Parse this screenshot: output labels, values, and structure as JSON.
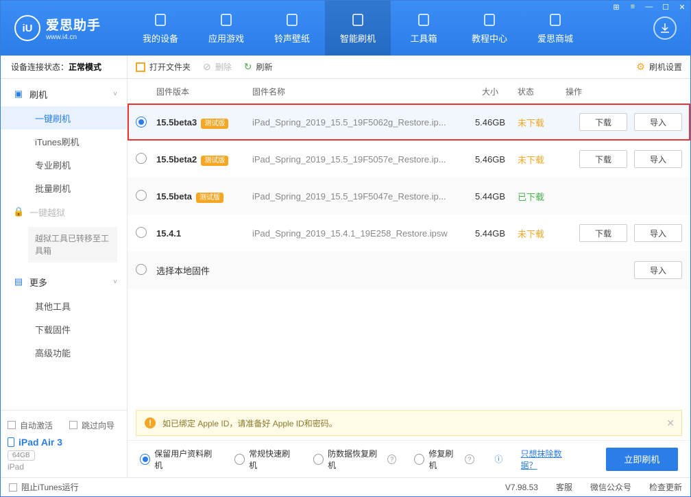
{
  "titlebar_icons": [
    "grid",
    "list",
    "min",
    "max",
    "close"
  ],
  "logo": {
    "cn": "爱思助手",
    "en": "www.i4.cn",
    "mark": "iU"
  },
  "nav": [
    {
      "id": "device",
      "label": "我的设备"
    },
    {
      "id": "apps",
      "label": "应用游戏"
    },
    {
      "id": "ringtone",
      "label": "铃声壁纸"
    },
    {
      "id": "flash",
      "label": "智能刷机"
    },
    {
      "id": "toolbox",
      "label": "工具箱"
    },
    {
      "id": "tutorial",
      "label": "教程中心"
    },
    {
      "id": "store",
      "label": "爱思商城"
    }
  ],
  "nav_active": "flash",
  "conn": {
    "label": "设备连接状态：",
    "value": "正常模式"
  },
  "tree": {
    "flash": {
      "label": "刷机",
      "expanded": true,
      "items": [
        {
          "id": "oneclick",
          "label": "一键刷机"
        },
        {
          "id": "itunes",
          "label": "iTunes刷机"
        },
        {
          "id": "pro",
          "label": "专业刷机"
        },
        {
          "id": "batch",
          "label": "批量刷机"
        }
      ],
      "active": "oneclick"
    },
    "jailbreak": {
      "label": "一键越狱",
      "note": "越狱工具已转移至工具箱"
    },
    "more": {
      "label": "更多",
      "expanded": true,
      "items": [
        {
          "id": "other",
          "label": "其他工具"
        },
        {
          "id": "download",
          "label": "下载固件"
        },
        {
          "id": "adv",
          "label": "高级功能"
        }
      ]
    }
  },
  "auto": {
    "activate": "自动激活",
    "skip": "跳过向导"
  },
  "device": {
    "name": "iPad Air 3",
    "capacity": "64GB",
    "type": "iPad"
  },
  "toolbar": {
    "open": "打开文件夹",
    "delete": "删除",
    "refresh": "刷新",
    "settings": "刷机设置"
  },
  "columns": {
    "ver": "固件版本",
    "name": "固件名称",
    "size": "大小",
    "status": "状态",
    "ops": "操作"
  },
  "status_text": {
    "not": "未下载",
    "done": "已下载"
  },
  "op_labels": {
    "download": "下载",
    "import": "导入"
  },
  "beta_tag": "测试版",
  "firmware": [
    {
      "selected": true,
      "version": "15.5beta3",
      "beta": true,
      "file": "iPad_Spring_2019_15.5_19F5062g_Restore.ip...",
      "size": "5.46GB",
      "status": "not",
      "ops": [
        "download",
        "import"
      ],
      "hl": true
    },
    {
      "selected": false,
      "version": "15.5beta2",
      "beta": true,
      "file": "iPad_Spring_2019_15.5_19F5057e_Restore.ip...",
      "size": "5.46GB",
      "status": "not",
      "ops": [
        "download",
        "import"
      ]
    },
    {
      "selected": false,
      "version": "15.5beta",
      "beta": true,
      "file": "iPad_Spring_2019_15.5_19F5047e_Restore.ip...",
      "size": "5.44GB",
      "status": "done",
      "ops": [],
      "stripe": true
    },
    {
      "selected": false,
      "version": "15.4.1",
      "beta": false,
      "file": "iPad_Spring_2019_15.4.1_19E258_Restore.ipsw",
      "size": "5.44GB",
      "status": "not",
      "ops": [
        "download",
        "import"
      ]
    },
    {
      "selected": false,
      "version": "",
      "beta": false,
      "file": "",
      "size": "",
      "status": "",
      "ops": [
        "import"
      ],
      "local": true,
      "local_label": "选择本地固件",
      "stripe": true
    }
  ],
  "warn": "如已绑定 Apple ID，请准备好 Apple ID和密码。",
  "modes": [
    {
      "id": "keep",
      "label": "保留用户资料刷机",
      "on": true
    },
    {
      "id": "normal",
      "label": "常规快速刷机"
    },
    {
      "id": "recover",
      "label": "防数据恢复刷机",
      "q": true
    },
    {
      "id": "repair",
      "label": "修复刷机",
      "q": true
    }
  ],
  "erase_link": "只想抹除数据？",
  "go": "立即刷机",
  "footer": {
    "block": "阻止iTunes运行",
    "version": "V7.98.53",
    "support": "客服",
    "wechat": "微信公众号",
    "update": "检查更新"
  }
}
